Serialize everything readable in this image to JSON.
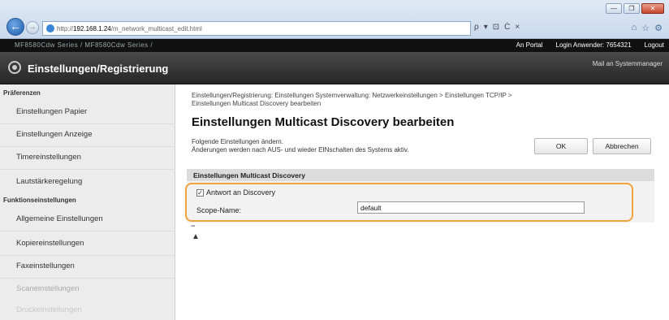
{
  "browser": {
    "url_prefix": "http://",
    "url_host": "192.168.1.24",
    "url_path": "/m_network_multicast_edit.html",
    "addr_tools": [
      "ρ",
      "▾",
      "⊡",
      "Ċ",
      "×"
    ],
    "fav_tools": [
      "⌂",
      "☆",
      "⚙"
    ],
    "window_controls": [
      "—",
      "❐",
      "✕"
    ]
  },
  "topbar": {
    "device_name": "MF8580Cdw Series / MF8580Cdw Series /",
    "remote_ui": "An Portal",
    "login_user_label": "Login Anwender:",
    "login_user": "7654321",
    "logout": "Logout"
  },
  "header": {
    "title": "Einstellungen/Registrierung",
    "mail_admin": "Mail an Systemmanager"
  },
  "sidebar": {
    "sections": [
      {
        "heading": "Präferenzen",
        "items": [
          "Einstellungen Papier",
          "Einstellungen Anzeige",
          "Timereinstellungen",
          "Lautstärkeregelung"
        ]
      },
      {
        "heading": "Funktionseinstellungen",
        "items": [
          "Allgemeine Einstellungen",
          "Kopiereinstellungen",
          "Faxeinstellungen",
          "Scaneinstellungen",
          "Druckeinstellungen"
        ]
      }
    ]
  },
  "main": {
    "breadcrumb_line1": "Einstellungen/Registrierung: Einstellungen Systemverwaltung: Netzwerkeinstellungen > Einstellungen TCP/IP >",
    "breadcrumb_line2": "Einstellungen Multicast Discovery bearbeiten",
    "title": "Einstellungen Multicast Discovery bearbeiten",
    "info_line1": "Folgende Einstellungen ändern.",
    "info_line2": "Änderungen werden nach AUS- und wieder EINschalten des Systems aktiv.",
    "ok_label": "OK",
    "cancel_label": "Abbrechen",
    "section_title": "Einstellungen Multicast Discovery",
    "respond_label": "Antwort an Discovery",
    "respond_checked": true,
    "scope_label": "Scope-Name:",
    "scope_value": "default",
    "to_top_icon": "arrow-to-top-icon"
  }
}
